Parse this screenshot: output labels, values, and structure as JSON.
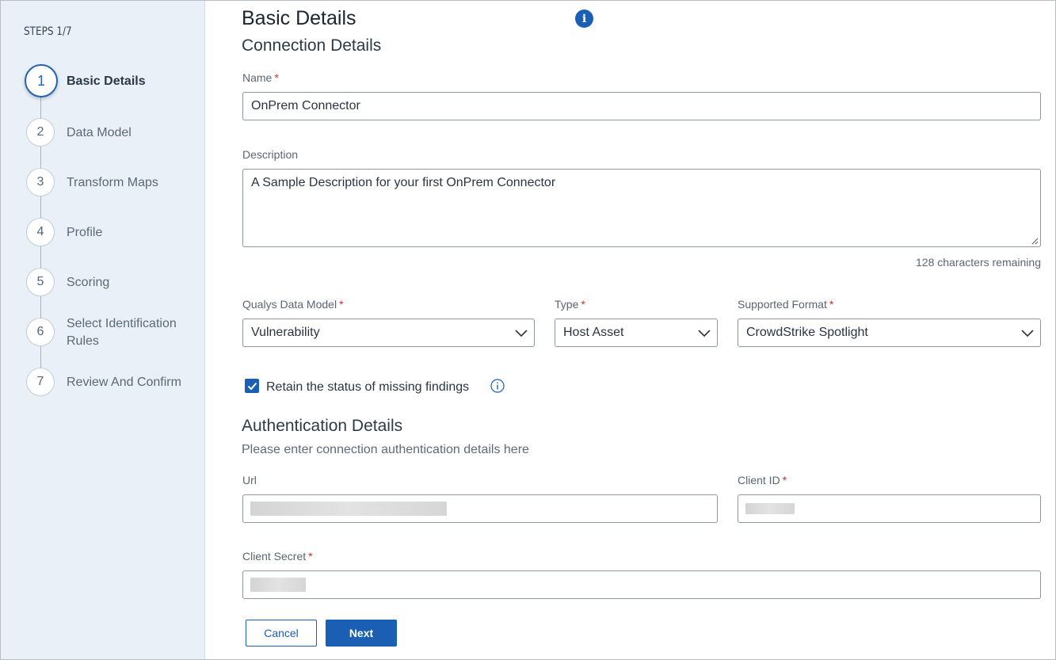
{
  "sidebar": {
    "steps_label": "STEPS 1/7",
    "steps": [
      {
        "number": "1",
        "label": "Basic Details",
        "active": true
      },
      {
        "number": "2",
        "label": "Data Model"
      },
      {
        "number": "3",
        "label": "Transform Maps"
      },
      {
        "number": "4",
        "label": "Profile"
      },
      {
        "number": "5",
        "label": "Scoring"
      },
      {
        "number": "6",
        "label": "Select Identification Rules"
      },
      {
        "number": "7",
        "label": "Review And Confirm"
      }
    ]
  },
  "header": {
    "title": "Basic Details",
    "info_icon": "info-icon"
  },
  "connection": {
    "title": "Connection Details",
    "name_label": "Name",
    "name_value": "OnPrem Connector",
    "description_label": "Description",
    "description_value": "A Sample Description for your first OnPrem Connector",
    "chars_remaining": "128 characters remaining",
    "data_model_label": "Qualys Data Model",
    "data_model_value": "Vulnerability",
    "type_label": "Type",
    "type_value": "Host Asset",
    "format_label": "Supported Format",
    "format_value": "CrowdStrike Spotlight",
    "retain_label": "Retain the status of missing findings",
    "retain_checked": true
  },
  "authentication": {
    "title": "Authentication Details",
    "subtitle": "Please enter connection authentication details here",
    "url_label": "Url",
    "client_id_label": "Client ID",
    "client_secret_label": "Client Secret"
  },
  "footer": {
    "cancel_label": "Cancel",
    "next_label": "Next"
  },
  "required_marker": "*",
  "colors": {
    "accent": "#1a5fb4",
    "required": "#d22d2d",
    "sidebar_bg": "#eaf0f7"
  }
}
